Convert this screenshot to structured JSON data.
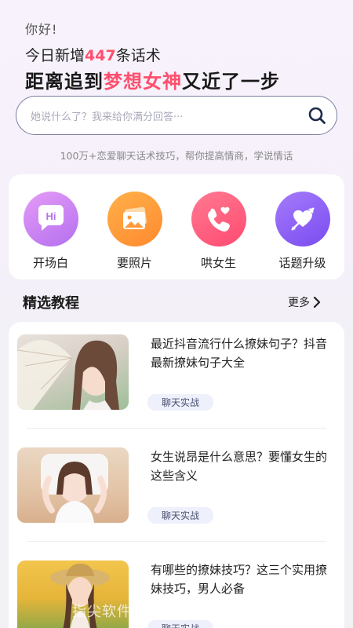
{
  "header": {
    "greeting": "你好!",
    "today_prefix": "今日新增",
    "today_count": "447",
    "today_suffix": "条话术",
    "slogan_prefix": "距离追到",
    "slogan_highlight": "梦想女神",
    "slogan_suffix": "又近了一步"
  },
  "search": {
    "placeholder": "她说什么了？我来给你满分回答···"
  },
  "tagline": "100万+恋爱聊天话术技巧，帮你提高情商，学说情话",
  "features": [
    {
      "label": "开场白",
      "icon": "hi-chat-icon"
    },
    {
      "label": "要照片",
      "icon": "photo-icon"
    },
    {
      "label": "哄女生",
      "icon": "phone-heart-icon"
    },
    {
      "label": "话题升级",
      "icon": "heart-arrow-icon"
    }
  ],
  "section": {
    "title": "精选教程",
    "more": "更多"
  },
  "articles": [
    {
      "title": "最近抖音流行什么撩妹句子？抖音最新撩妹句子大全",
      "tag": "聊天实战"
    },
    {
      "title": "女生说昂是什么意思？要懂女生的这些含义",
      "tag": "聊天实战"
    },
    {
      "title": "有哪些的撩妹技巧？这三个实用撩妹技巧，男人必备",
      "tag": "聊天实战"
    }
  ],
  "watermark": "指尖软件 • ZJHHRJ.COM",
  "colors": {
    "accent": "#ff4f6e",
    "feature1": "#c77bf0",
    "feature2": "#ff9a3c",
    "feature3": "#ff5b7e",
    "feature4": "#8a5cf5"
  }
}
